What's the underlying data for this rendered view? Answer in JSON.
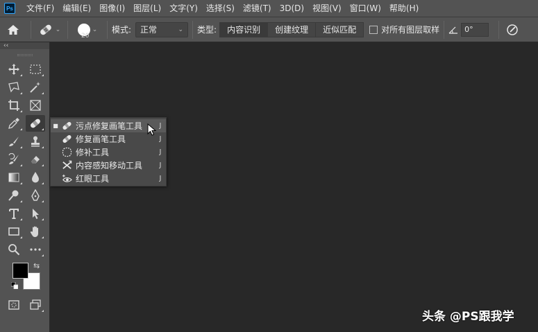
{
  "app": {
    "logo": "Ps"
  },
  "menubar": {
    "items": [
      "文件(F)",
      "编辑(E)",
      "图像(I)",
      "图层(L)",
      "文字(Y)",
      "选择(S)",
      "滤镜(T)",
      "3D(D)",
      "视图(V)",
      "窗口(W)",
      "帮助(H)"
    ]
  },
  "options": {
    "brush_size": "20",
    "mode_label": "模式:",
    "mode_value": "正常",
    "type_label": "类型:",
    "type_options": [
      "内容识别",
      "创建纹理",
      "近似匹配"
    ],
    "sample_all_layers": "对所有图层取样",
    "angle_value": "0°"
  },
  "toolbar": {
    "collapse": "‹‹",
    "flyout": {
      "items": [
        {
          "label": "污点修复画笔工具",
          "shortcut": "J",
          "active": true,
          "icon": "spot-healing-brush-icon"
        },
        {
          "label": "修复画笔工具",
          "shortcut": "J",
          "active": false,
          "icon": "healing-brush-icon"
        },
        {
          "label": "修补工具",
          "shortcut": "J",
          "active": false,
          "icon": "patch-icon"
        },
        {
          "label": "内容感知移动工具",
          "shortcut": "J",
          "active": false,
          "icon": "content-aware-move-icon"
        },
        {
          "label": "红眼工具",
          "shortcut": "J",
          "active": false,
          "icon": "red-eye-icon"
        }
      ]
    }
  },
  "colors": {
    "foreground": "#000000",
    "background": "#ffffff"
  },
  "watermark": "头条 @PS跟我学"
}
